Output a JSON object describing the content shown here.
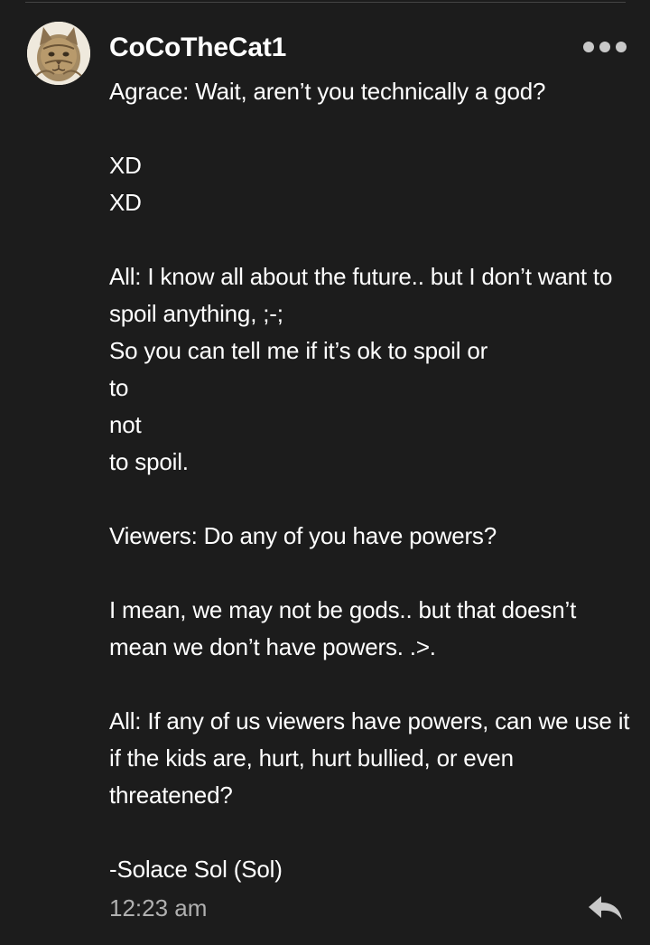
{
  "comment": {
    "username": "CoCoTheCat1",
    "body": "Agrace: Wait, aren’t you technically a god?\n\nXD\nXD\n\nAll: I know all about the future.. but I don’t want to spoil anything, ;-;\nSo you can tell me if it’s ok to spoil or\nto\nnot\nto spoil.\n\nViewers: Do any of you have powers?\n\nI mean, we may not be gods.. but that doesn’t mean we don’t have powers. .>.\n\nAll: If any of us viewers have powers, can we use it if the kids are, hurt, hurt bullied, or even threatened?\n\n-Solace Sol (Sol)",
    "timestamp": "12:23 am",
    "avatar_icon": "cat-avatar",
    "more_icon": "more-options-icon",
    "reply_icon": "reply-arrow-icon"
  },
  "colors": {
    "background": "#1c1c1c",
    "text": "#ffffff",
    "timestamp": "#b0b0b0",
    "icon": "#c8c8c8"
  }
}
